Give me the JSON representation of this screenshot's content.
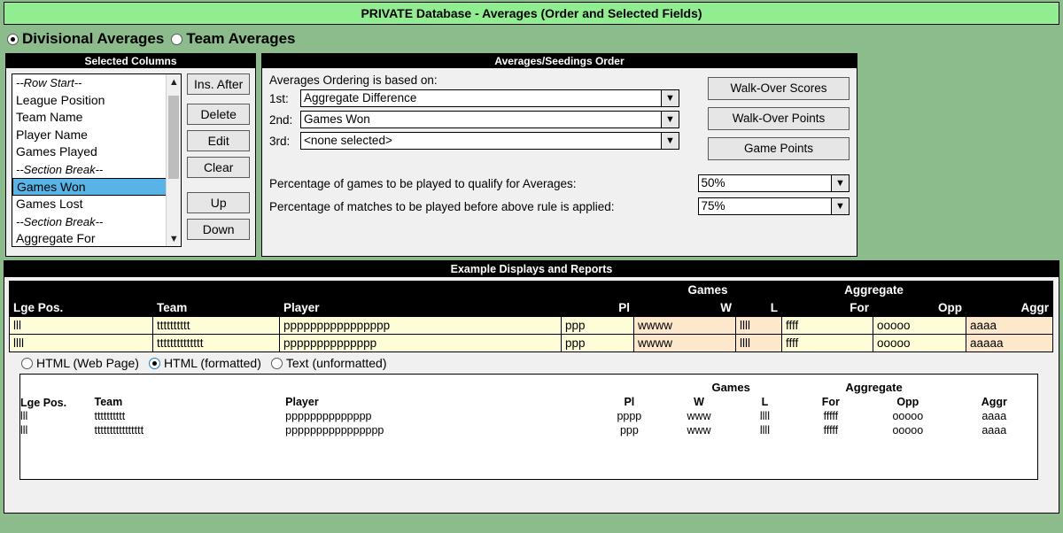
{
  "window": {
    "title": "PRIVATE Database - Averages (Order and Selected Fields)"
  },
  "mode": {
    "options": [
      {
        "label": "Divisional Averages",
        "selected": true
      },
      {
        "label": "Team Averages",
        "selected": false
      }
    ]
  },
  "selected_columns": {
    "title": "Selected Columns",
    "items": [
      {
        "label": "--Row Start--",
        "type": "separator",
        "selected": false
      },
      {
        "label": "League Position",
        "type": "field",
        "selected": false
      },
      {
        "label": "Team Name",
        "type": "field",
        "selected": false
      },
      {
        "label": "Player Name",
        "type": "field",
        "selected": false
      },
      {
        "label": "Games Played",
        "type": "field",
        "selected": false
      },
      {
        "label": "--Section Break--",
        "type": "separator",
        "selected": false
      },
      {
        "label": "Games Won",
        "type": "field",
        "selected": true
      },
      {
        "label": "Games Lost",
        "type": "field",
        "selected": false
      },
      {
        "label": "--Section Break--",
        "type": "separator",
        "selected": false
      },
      {
        "label": "Aggregate For",
        "type": "field",
        "selected": false
      }
    ],
    "buttons": [
      {
        "label": "Ins. After",
        "name": "ins-after-button"
      },
      {
        "label": "Delete",
        "name": "delete-button"
      },
      {
        "label": "Edit",
        "name": "edit-button"
      },
      {
        "label": "Clear",
        "name": "clear-button"
      },
      {
        "label": "Up",
        "name": "up-button"
      },
      {
        "label": "Down",
        "name": "down-button"
      }
    ]
  },
  "averages_order": {
    "title": "Averages/Seedings Order",
    "lead": "Averages Ordering is based on:",
    "rows": [
      {
        "label": "1st:",
        "value": "Aggregate Difference"
      },
      {
        "label": "2nd:",
        "value": "Games Won"
      },
      {
        "label": "3rd:",
        "value": "<none selected>"
      }
    ],
    "buttons": [
      {
        "label": "Walk-Over Scores",
        "name": "walk-over-scores-button"
      },
      {
        "label": "Walk-Over Points",
        "name": "walk-over-points-button"
      },
      {
        "label": "Game Points",
        "name": "game-points-button"
      }
    ],
    "percentages": [
      {
        "label": "Percentage of games to be played to qualify for Averages:",
        "value": "50%"
      },
      {
        "label": "Percentage of matches to be played before above rule is applied:",
        "value": "75%"
      }
    ]
  },
  "example_displays": {
    "title": "Example Displays and Reports",
    "table": {
      "group_headers": [
        {
          "label": "",
          "span": 4
        },
        {
          "label": "Games",
          "span": 2
        },
        {
          "label": "Aggregate",
          "span": 2
        },
        {
          "label": "",
          "span": 1
        }
      ],
      "columns": [
        {
          "label": "Lge Pos.",
          "align": "left"
        },
        {
          "label": "Team",
          "align": "left"
        },
        {
          "label": "Player",
          "align": "left"
        },
        {
          "label": "Pl",
          "align": "right"
        },
        {
          "label": "W",
          "align": "right"
        },
        {
          "label": "L",
          "align": "right"
        },
        {
          "label": "For",
          "align": "right"
        },
        {
          "label": "Opp",
          "align": "right"
        },
        {
          "label": "Aggr",
          "align": "right"
        }
      ],
      "rows": [
        [
          "lll",
          "tttttttttt",
          "pppppppppppppppp",
          "ppp",
          "wwww",
          "llll",
          "ffff",
          "ooooo",
          "aaaa"
        ],
        [
          "llll",
          "tttttttttttttt",
          "pppppppppppppp",
          "ppp",
          "wwww",
          "llll",
          "ffff",
          "ooooo",
          "aaaaa"
        ]
      ]
    },
    "format_options": [
      {
        "label": "HTML (Web Page)",
        "selected": false
      },
      {
        "label": "HTML (formatted)",
        "selected": true
      },
      {
        "label": "Text (unformatted)",
        "selected": false
      }
    ],
    "preview": {
      "group_headers": [
        {
          "label": "Games"
        },
        {
          "label": "Aggregate"
        }
      ],
      "columns": [
        "Lge Pos.",
        "Team",
        "Player",
        "Pl",
        "W",
        "L",
        "For",
        "Opp",
        "Aggr"
      ],
      "rows": [
        [
          "lll",
          "tttttttttt",
          "pppppppppppppp",
          "pppp",
          "www",
          "llll",
          "fffff",
          "ooooo",
          "aaaa"
        ],
        [
          "lll",
          "tttttttttttttttt",
          "pppppppppppppppp",
          "ppp",
          "www",
          "llll",
          "fffff",
          "ooooo",
          "aaaa"
        ]
      ]
    }
  },
  "colors": {
    "background": "#8cbc8c",
    "title_bar": "#90ee90",
    "selection": "#58b4e6",
    "cell_light": "#fffdd8",
    "cell_peach": "#fde8cc",
    "header": "#000000"
  }
}
